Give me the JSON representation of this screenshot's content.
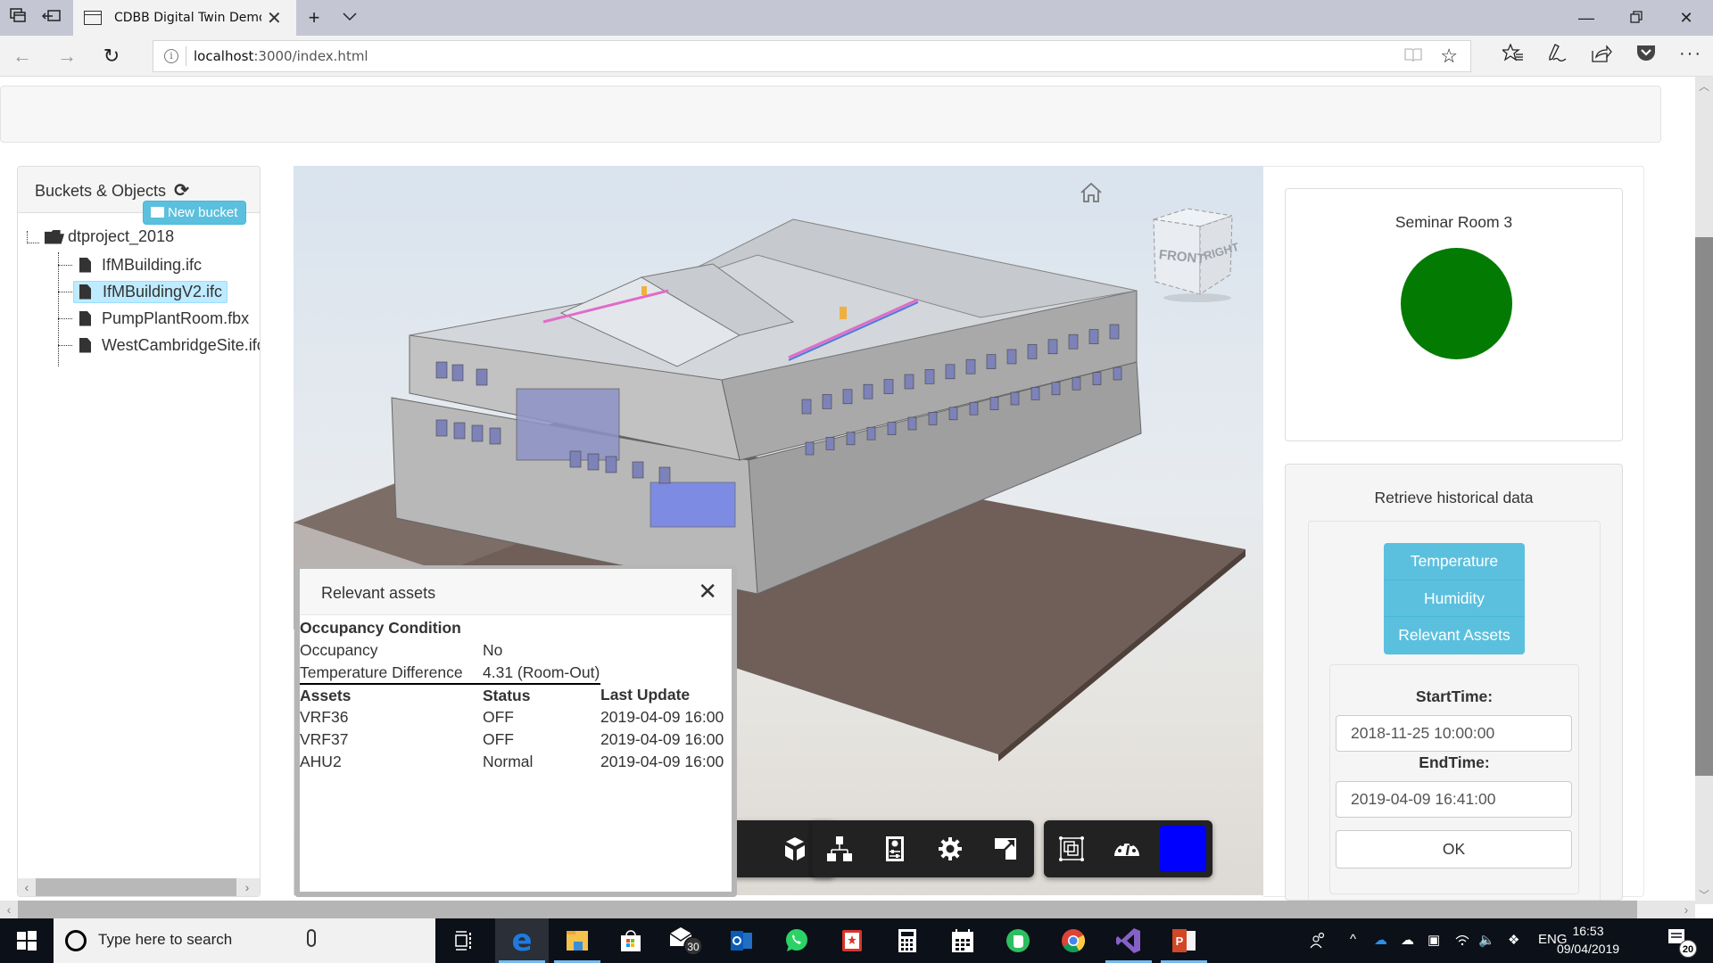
{
  "browser": {
    "tab_title": "CDBB Digital Twin Demo",
    "url_host": "localhost",
    "url_rest": ":3000/index.html",
    "window_controls": [
      "minimize",
      "restore",
      "close"
    ]
  },
  "left_panel": {
    "title": "Buckets & Objects",
    "new_bucket_label": "New bucket",
    "tree": {
      "root": "dtproject_2018",
      "items": [
        {
          "label": "IfMBuilding.ifc",
          "selected": false
        },
        {
          "label": "IfMBuildingV2.ifc",
          "selected": true
        },
        {
          "label": "PumpPlantRoom.fbx",
          "selected": false
        },
        {
          "label": "WestCambridgeSite.ifc",
          "selected": false
        }
      ]
    }
  },
  "viewer": {
    "viewcube_faces": {
      "front": "FRONT",
      "right": "RIGHT"
    },
    "highlight_color": "#0000ff",
    "toolbar_groups": [
      [
        "model-browser"
      ],
      [
        "structure",
        "properties",
        "settings",
        "fullscreen"
      ],
      [
        "section-box",
        "performance",
        "color-picker"
      ]
    ]
  },
  "dialog": {
    "title": "Relevant assets",
    "occupancy_section": "Occupancy Condition",
    "occupancy_rows": [
      {
        "label": "Occupancy",
        "value": "No"
      },
      {
        "label": "Temperature Difference",
        "value": "4.31 (Room-Out)"
      }
    ],
    "assets_headers": [
      "Assets",
      "Status",
      "Last Update"
    ],
    "assets": [
      {
        "name": "VRF36",
        "status": "OFF",
        "last_update": "2019-04-09 16:00"
      },
      {
        "name": "VRF37",
        "status": "OFF",
        "last_update": "2019-04-09 16:00"
      },
      {
        "name": "AHU2",
        "status": "Normal",
        "last_update": "2019-04-09 16:00"
      }
    ]
  },
  "room_card": {
    "title": "Seminar Room 3",
    "status_color": "#037b03"
  },
  "history_card": {
    "title": "Retrieve historical data",
    "buttons": [
      "Temperature",
      "Humidity",
      "Relevant Assets"
    ],
    "start_label": "StartTime:",
    "start_value": "2018-11-25 10:00:00",
    "end_label": "EndTime:",
    "end_value": "2019-04-09 16:41:00",
    "ok_label": "OK"
  },
  "taskbar": {
    "search_placeholder": "Type here to search",
    "mail_badge": "30",
    "language": "ENG",
    "time": "16:53",
    "date": "09/04/2019",
    "notification_count": "20"
  }
}
